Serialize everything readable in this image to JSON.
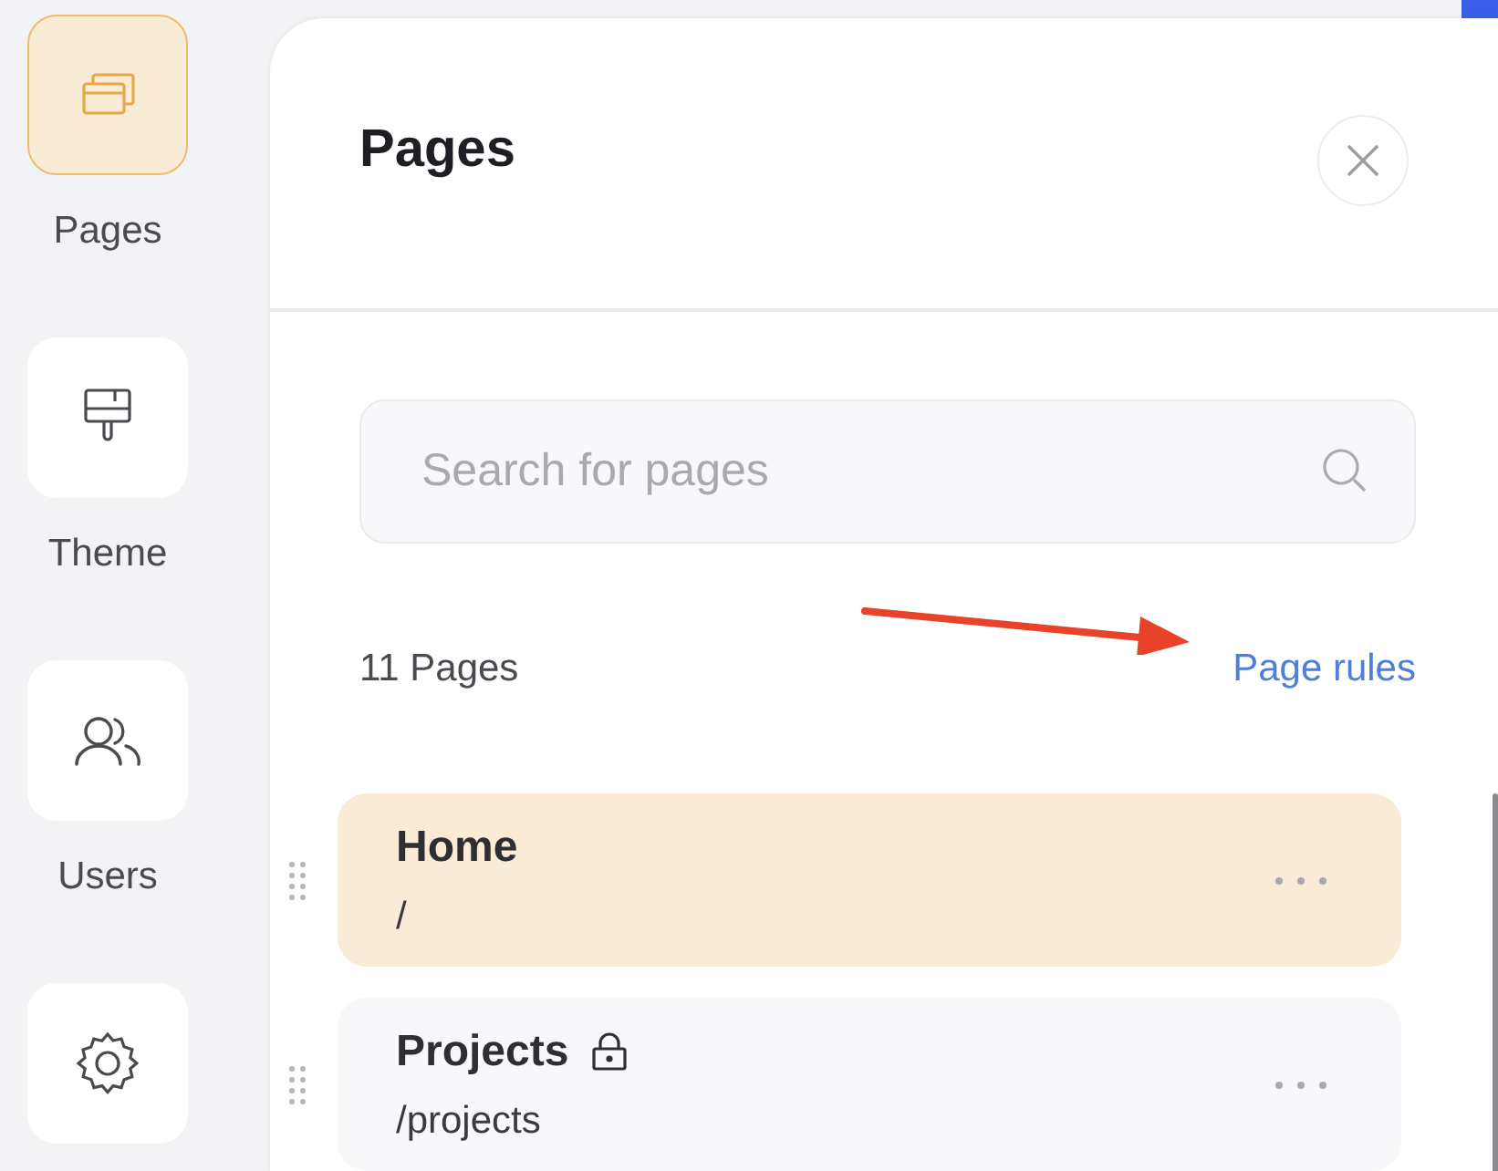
{
  "nav": [
    {
      "label": "Pages",
      "kind": "pages",
      "selected": true
    },
    {
      "label": "Theme",
      "kind": "brush",
      "selected": false
    },
    {
      "label": "Users",
      "kind": "users",
      "selected": false
    },
    {
      "kind": "settings",
      "selected": false
    }
  ],
  "panel": {
    "title": "Pages",
    "search": {
      "placeholder": "Search for pages"
    },
    "count": "11 Pages",
    "rules_link": "Page rules",
    "pages": [
      {
        "name": "Home",
        "path": "/",
        "selected": true,
        "locked": false
      },
      {
        "name": "Projects",
        "path": "/projects",
        "selected": false,
        "locked": true
      }
    ]
  }
}
